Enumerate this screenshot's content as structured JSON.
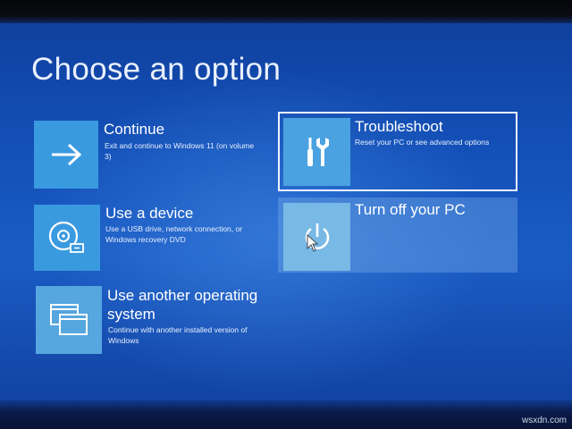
{
  "page": {
    "title": "Choose an option"
  },
  "options": [
    {
      "id": "continue",
      "label": "Continue",
      "description": "Exit and continue to Windows 11 (on volume 3)",
      "icon": "arrow-right-icon"
    },
    {
      "id": "use-device",
      "label": "Use a device",
      "description": "Use a USB drive, network connection, or Windows recovery DVD",
      "icon": "disc-drive-icon"
    },
    {
      "id": "use-other-os",
      "label": "Use another operating system",
      "description": "Continue with another installed version of Windows",
      "icon": "windows-stack-icon"
    },
    {
      "id": "troubleshoot",
      "label": "Troubleshoot",
      "description": "Reset your PC or see advanced options",
      "icon": "tools-icon",
      "selected": true
    },
    {
      "id": "turn-off",
      "label": "Turn off your PC",
      "description": "",
      "icon": "power-icon"
    }
  ],
  "watermark": "wsxdn.com",
  "colors": {
    "background": "#1350b8",
    "tile_icon": "#3a9ae0",
    "text": "#ffffff",
    "focus_border": "#f0f4ff"
  }
}
